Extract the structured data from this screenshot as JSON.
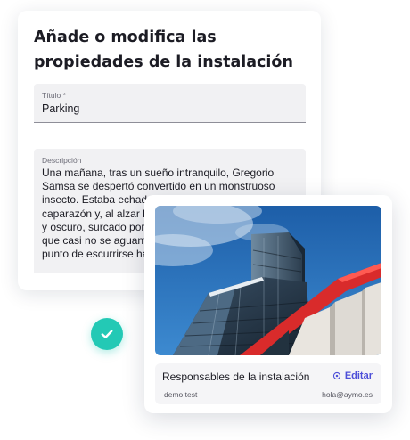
{
  "form": {
    "title": "Añade o modifica las propiedades de la instalación",
    "title_field": {
      "label": "Título *",
      "value": "Parking"
    },
    "description_field": {
      "label": "Descripción",
      "value": "Una mañana, tras un sueño intranquilo, Gregorio Samsa se despertó convertido en un monstruoso insecto. Estaba echado de espaldas sobre un duro caparazón y, al alzar la cabeza, vio su vientre convexo y oscuro, surcado por curvadas callosidades, sobre el que casi no se aguantaba la colcha, que estaba a punto de escurrirse hasta el suelo."
    }
  },
  "status": {
    "icon": "check-icon",
    "color": "#23c9b5"
  },
  "facility": {
    "image": "building-photo",
    "responsibles_title": "Responsables de la instalación",
    "edit_label": "Editar",
    "edit_icon": "gear-icon",
    "responsible_name": "demo test",
    "responsible_email": "hola@aymo.es",
    "accent_color": "#4d4fd8"
  }
}
